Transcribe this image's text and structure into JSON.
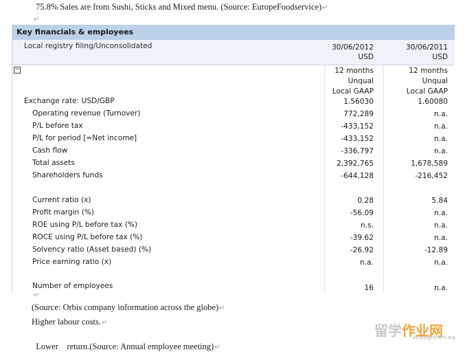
{
  "top_line": "75.8% Sales are from Sushi, Sticks and Mixed menu. (Source: EuropeFoodservice)",
  "paragraph_mark": "↵",
  "table": {
    "title": "Key financials & employees",
    "subheader_label": "Local registry filing/Unconsolidated",
    "columns": [
      {
        "date": "30/06/2012",
        "currency": "USD"
      },
      {
        "date": "30/06/2011",
        "currency": "USD"
      }
    ],
    "expander": "−",
    "meta_rows": [
      [
        "12 months",
        "12 months"
      ],
      [
        "Unqual",
        "Unqual"
      ],
      [
        "Local GAAP",
        "Local GAAP"
      ]
    ],
    "exchange_label": "Exchange rate: USD/GBP",
    "exchange_values": [
      "1.56030",
      "1.60080"
    ],
    "group1": [
      {
        "label": "Operating revenue (Turnover)",
        "v1": "772,289",
        "v2": "n.a."
      },
      {
        "label": "P/L before tax",
        "v1": "-433,152",
        "v2": "n.a."
      },
      {
        "label": "P/L for period [=Net income]",
        "v1": "-433,152",
        "v2": "n.a."
      },
      {
        "label": "Cash flow",
        "v1": "-336,797",
        "v2": "n.a."
      },
      {
        "label": "Total assets",
        "v1": "2,392,765",
        "v2": "1,678,589"
      },
      {
        "label": "Shareholders funds",
        "v1": "-644,128",
        "v2": "-216,452"
      }
    ],
    "group2": [
      {
        "label": "Current ratio (x)",
        "v1": "0.28",
        "v2": "5.84"
      },
      {
        "label": "Profit margin (%)",
        "v1": "-56.09",
        "v2": "n.a."
      },
      {
        "label": "ROE using P/L before tax (%)",
        "v1": "n.s.",
        "v2": "n.a."
      },
      {
        "label": "ROCE using P/L before tax (%)",
        "v1": "-39.62",
        "v2": "n.a."
      },
      {
        "label": "Solvency ratio (Asset based) (%)",
        "v1": "-26.92",
        "v2": "-12.89"
      },
      {
        "label": "Price earning ratio (x)",
        "v1": "n.a.",
        "v2": "n.a."
      }
    ],
    "employees": {
      "label": "Number of employees",
      "v1": "16",
      "v2": "n.a."
    }
  },
  "bottom_lines": [
    "(Source: Orbis company information across the globe)",
    "Higher labour costs.",
    "Lower    return.(Source: Annual employee meeting)"
  ],
  "watermark": {
    "part1": "留学",
    "part2": "作业",
    "part3": "网",
    "url": "ukassignment.org"
  }
}
